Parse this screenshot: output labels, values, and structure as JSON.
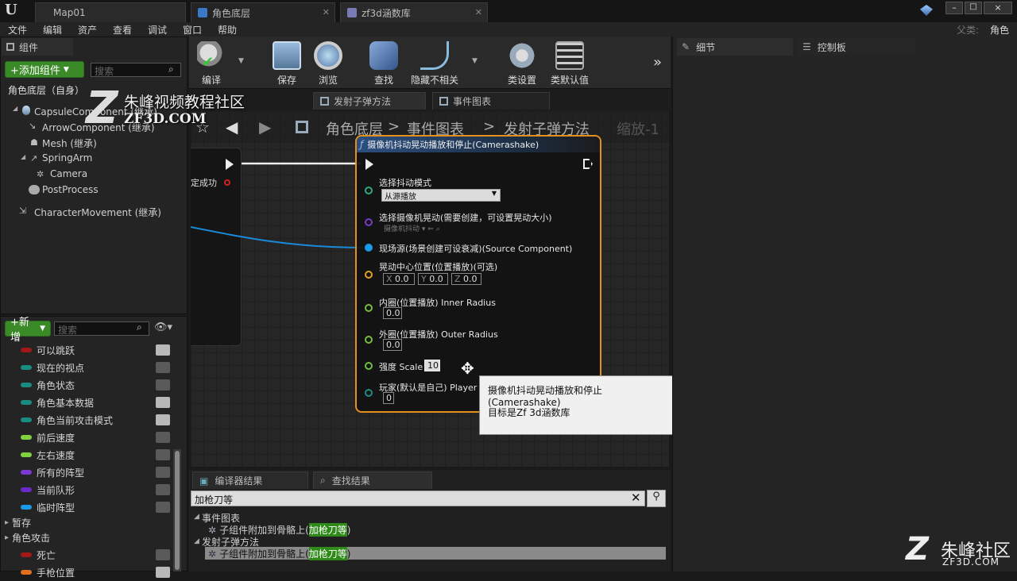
{
  "titlebar": {
    "logo": "U",
    "tabs": [
      {
        "label": "Map01"
      },
      {
        "label": "角色底层"
      },
      {
        "label": "zf3d涵数库"
      }
    ],
    "window_buttons": [
      "–",
      "□",
      "×"
    ]
  },
  "menubar": {
    "items": [
      "文件",
      "编辑",
      "资产",
      "查看",
      "调试",
      "窗口",
      "帮助"
    ],
    "parent_label": "父类:",
    "parent_value": "角色"
  },
  "components_panel": {
    "title": "组件",
    "add_button": "+添加组件",
    "search_placeholder": "搜索",
    "root": "角色底层（自身）",
    "items": [
      {
        "label": "CapsuleComponent (继承)"
      },
      {
        "label": "ArrowComponent (继承)"
      },
      {
        "label": "Mesh (继承)"
      },
      {
        "label": "SpringArm"
      },
      {
        "label": "Camera"
      },
      {
        "label": "PostProcess"
      },
      {
        "label": "CharacterMovement (继承)"
      }
    ]
  },
  "watermark": {
    "line1": "朱峰视频教程社区",
    "line2": "ZF3D.COM",
    "corner_text": "朱峰社区",
    "corner_url": "ZF3D.COM"
  },
  "mybp_panel": {
    "add_button": "+新增",
    "search_placeholder": "搜索",
    "variables": [
      {
        "label": "可以跳跃",
        "color": "#a01818",
        "eye": true
      },
      {
        "label": "现在的视点",
        "color": "#1a8c80",
        "eye": false
      },
      {
        "label": "角色状态",
        "color": "#1a8c80",
        "eye": false
      },
      {
        "label": "角色基本数据",
        "color": "#1a8c80",
        "eye": true
      },
      {
        "label": "角色当前攻击模式",
        "color": "#1a8c80",
        "eye": true
      },
      {
        "label": "前后速度",
        "color": "#80d040",
        "eye": false
      },
      {
        "label": "左右速度",
        "color": "#80d040",
        "eye": false
      },
      {
        "label": "所有的阵型",
        "color": "#7a3ad0",
        "eye": false
      },
      {
        "label": "当前队形",
        "color": "#6a2ac8",
        "eye": false
      },
      {
        "label": "临时阵型",
        "color": "#1a9ae8",
        "eye": false
      }
    ],
    "category_temp": "暂存",
    "category_attack": "角色攻击",
    "attack_vars": [
      {
        "label": "死亡",
        "color": "#a01818",
        "eye": false
      },
      {
        "label": "手枪位置",
        "color": "#e07020",
        "eye": true
      }
    ]
  },
  "toolbar": {
    "buttons": [
      {
        "label": "编译",
        "icon": "compile-icon"
      },
      {
        "label": "保存",
        "icon": "save-icon"
      },
      {
        "label": "浏览",
        "icon": "browse-icon"
      },
      {
        "label": "查找",
        "icon": "find-icon"
      },
      {
        "label": "隐藏不相关",
        "icon": "hide-unrelated-icon"
      },
      {
        "label": "类设置",
        "icon": "class-settings-icon"
      },
      {
        "label": "类默认值",
        "icon": "class-defaults-icon"
      }
    ],
    "more": "»"
  },
  "graph_tabs": [
    {
      "label": "发射子弹方法"
    },
    {
      "label": "事件图表"
    }
  ],
  "breadcrumb": {
    "items": [
      "角色底层",
      "事件图表",
      "发射子弹方法"
    ],
    "zoom": "缩放-1"
  },
  "left_node": {
    "label": "定成功"
  },
  "node": {
    "title": "摄像机抖动晃动播放和停止(Camerashake)",
    "params": [
      {
        "label": "选择抖动模式",
        "dropdown": "从源播放"
      },
      {
        "label": "选择摄像机晃动(需要创建，可设置晃动大小)",
        "dropdown": "摄像机抖动"
      },
      {
        "label": "现场源(场景创建可设衰减)(Source Component)"
      },
      {
        "label": "晃动中心位置(位置播放)(可选)",
        "x": "0.0",
        "y": "0.0",
        "z": "0.0"
      },
      {
        "label": "内圈(位置播放) Inner Radius",
        "value": "0.0"
      },
      {
        "label": "外圈(位置播放) Outer Radius",
        "value": "0.0"
      },
      {
        "label": "强度 Scale",
        "value": "10"
      },
      {
        "label": "玩家(默认是自己) Player I",
        "value": "0"
      }
    ],
    "axis_x": "X",
    "axis_y": "Y",
    "axis_z": "Z"
  },
  "tooltip": {
    "line1": "摄像机抖动晃动播放和停止(Camerashake)",
    "line2": "目标是Zf 3d涵数库"
  },
  "details_panel": {
    "tab1": "细节",
    "tab2": "控制板"
  },
  "results_panel": {
    "tab1": "编译器结果",
    "tab2": "查找结果",
    "search_value": "加枪刀等",
    "groups": [
      {
        "label": "事件图表",
        "item_prefix": "子组件附加到骨骼上(",
        "highlight": "加枪刀等",
        "item_suffix": ")"
      },
      {
        "label": "发射子弹方法",
        "item_prefix": "子组件附加到骨骼上(",
        "highlight": "加枪刀等",
        "item_suffix": ")"
      }
    ]
  }
}
